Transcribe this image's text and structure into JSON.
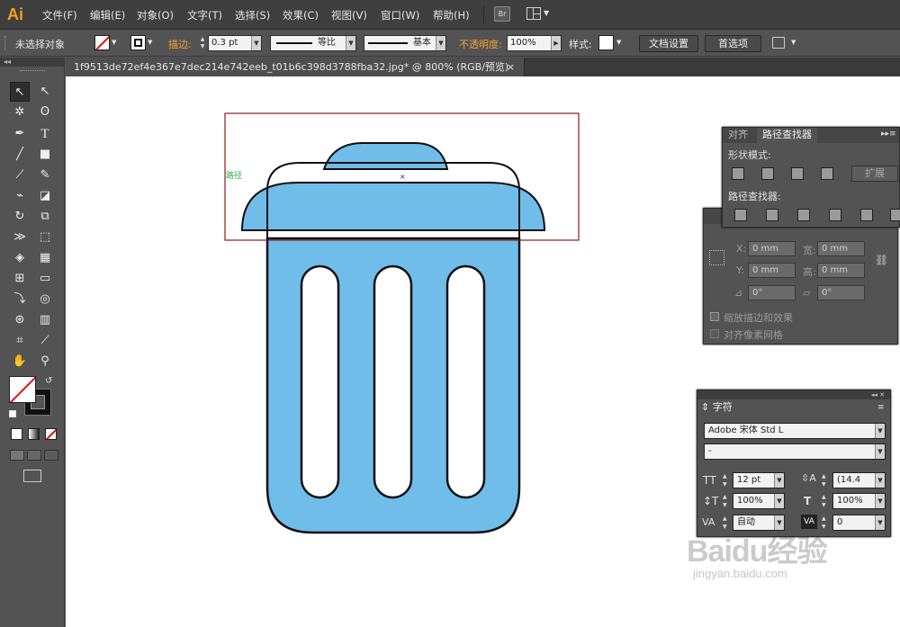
{
  "app": {
    "logo": "Ai"
  },
  "menu": [
    "文件(F)",
    "编辑(E)",
    "对象(O)",
    "文字(T)",
    "选择(S)",
    "效果(C)",
    "视图(V)",
    "窗口(W)",
    "帮助(H)"
  ],
  "menu_icons": {
    "bridge": "Br"
  },
  "control": {
    "selection_status": "未选择对象",
    "stroke_label": "描边:",
    "stroke_weight": "0.3 pt",
    "profile_uniform": "等比",
    "brush_basic": "基本",
    "opacity_label": "不透明度:",
    "opacity_value": "100%",
    "style_label": "样式:",
    "doc_setup_button": "文档设置",
    "preferences_button": "首选项"
  },
  "document_tab": {
    "title": "1f9513de72ef4e367e7dec214e742eeb_t01b6c398d3788fba32.jpg*  @  800%  (RGB/预览)",
    "close": "×"
  },
  "canvas": {
    "path_hint": "路径",
    "fill_color": "#70bdea",
    "stroke_color": "#111111",
    "selection_color": "#8b1c1c"
  },
  "pathfinder_panel": {
    "tab_align": "对齐",
    "tab_pathfinder": "路径查找器",
    "shape_modes_label": "形状模式:",
    "expand_button": "扩展",
    "pathfinders_label": "路径查找器:"
  },
  "transform_panel": {
    "x_label": "X:",
    "x_value": "0 mm",
    "y_label": "Y:",
    "y_value": "0 mm",
    "w_label": "宽:",
    "w_value": "0 mm",
    "h_label": "高:",
    "h_value": "0 mm",
    "rotate_value": "0°",
    "shear_value": "0°",
    "scale_strokes": "缩放描边和效果",
    "align_pixel": "对齐像素网格"
  },
  "character_panel": {
    "title": "字符",
    "font_family": "Adobe 宋体 Std L",
    "font_style": "-",
    "font_size": "12 pt",
    "leading": "(14.4",
    "vertical_scale": "100%",
    "horizontal_scale": "100%",
    "kerning": "自动",
    "tracking": "0"
  },
  "watermark": {
    "brand": "Baidu经验",
    "url": "jingyan.baidu.com"
  }
}
